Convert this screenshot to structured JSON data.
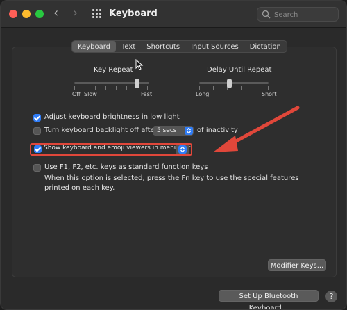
{
  "window": {
    "title": "Keyboard"
  },
  "search": {
    "placeholder": "Search"
  },
  "tabs": [
    {
      "label": "Keyboard",
      "selected": true
    },
    {
      "label": "Text",
      "selected": false
    },
    {
      "label": "Shortcuts",
      "selected": false
    },
    {
      "label": "Input Sources",
      "selected": false
    },
    {
      "label": "Dictation",
      "selected": false
    }
  ],
  "key_repeat": {
    "label": "Key Repeat",
    "min_label": "Off",
    "slow_label": "Slow",
    "max_label": "Fast",
    "value_fraction": 0.85
  },
  "delay_until_repeat": {
    "label": "Delay Until Repeat",
    "min_label": "Long",
    "max_label": "Short",
    "value_fraction": 0.45
  },
  "options": {
    "adjust_brightness": {
      "label": "Adjust keyboard brightness in low light",
      "checked": true
    },
    "backlight_off": {
      "label": "Turn keyboard backlight off after",
      "checked": false,
      "value": "5 secs",
      "suffix": "of inactivity"
    },
    "show_viewers": {
      "label": "Show keyboard and emoji viewers in menu bar",
      "checked": true
    },
    "fn_keys": {
      "label": "Use F1, F2, etc. keys as standard function keys",
      "checked": false,
      "description": "When this option is selected, press the Fn key to use the special features printed on each key."
    }
  },
  "buttons": {
    "modifier_keys": "Modifier Keys...",
    "bluetooth_setup": "Set Up Bluetooth Keyboard...",
    "help": "?"
  },
  "colors": {
    "accent": "#2f7cf6",
    "annotation": "#e0473a"
  }
}
